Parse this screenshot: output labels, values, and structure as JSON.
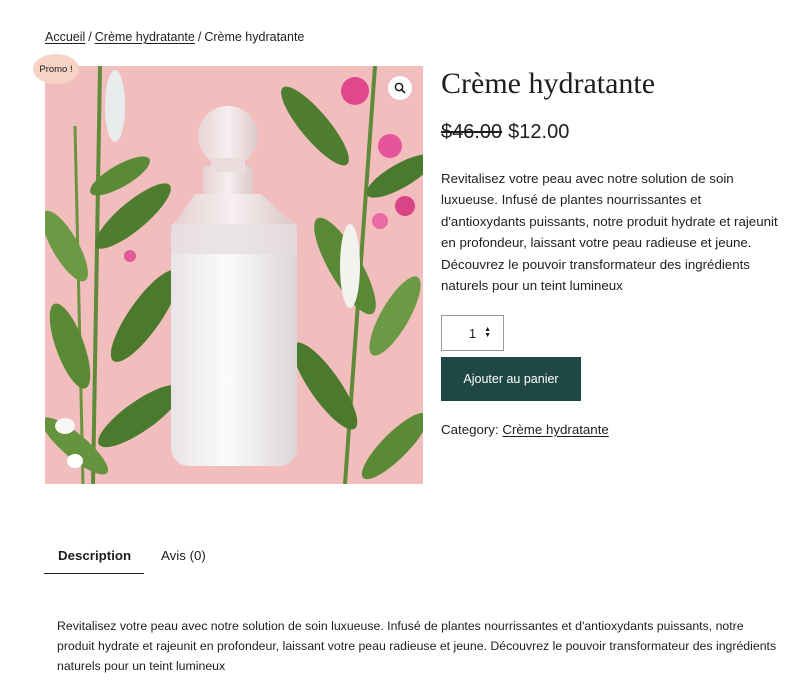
{
  "breadcrumb": {
    "home": "Accueil",
    "separator": "/",
    "category": "Crème hydratante",
    "current": "Crème hydratante"
  },
  "product": {
    "badge": "Promo !",
    "title": "Crème hydratante",
    "old_price": "$46.00",
    "price": "$12.00",
    "short_description": "Revitalisez votre peau avec notre solution de soin luxueuse. Infusé de plantes nourrissantes et d'antioxydants puissants, notre produit hydrate et rajeunit en profondeur, laissant votre peau radieuse et jeune. Découvrez le pouvoir transformateur des ingrédients naturels pour un teint lumineux",
    "quantity": "1",
    "add_to_cart": "Ajouter au panier",
    "category_label": "Category:",
    "category_link": "Crème hydratante",
    "image_icon": "zoom-icon"
  },
  "tabs": [
    {
      "label": "Description",
      "active": true
    },
    {
      "label": "Avis (0)",
      "active": false
    }
  ],
  "description_panel": "Revitalisez votre peau avec notre solution de soin luxueuse. Infusé de plantes nourrissantes et d'antioxydants puissants, notre produit hydrate et rajeunit en profondeur, laissant votre peau radieuse et jeune. Découvrez le pouvoir transformateur des ingrédients naturels pour un teint lumineux",
  "colors": {
    "button_bg": "#1f4745",
    "badge_bg": "#f6d3c4",
    "image_bg": "#f2bdbd"
  }
}
